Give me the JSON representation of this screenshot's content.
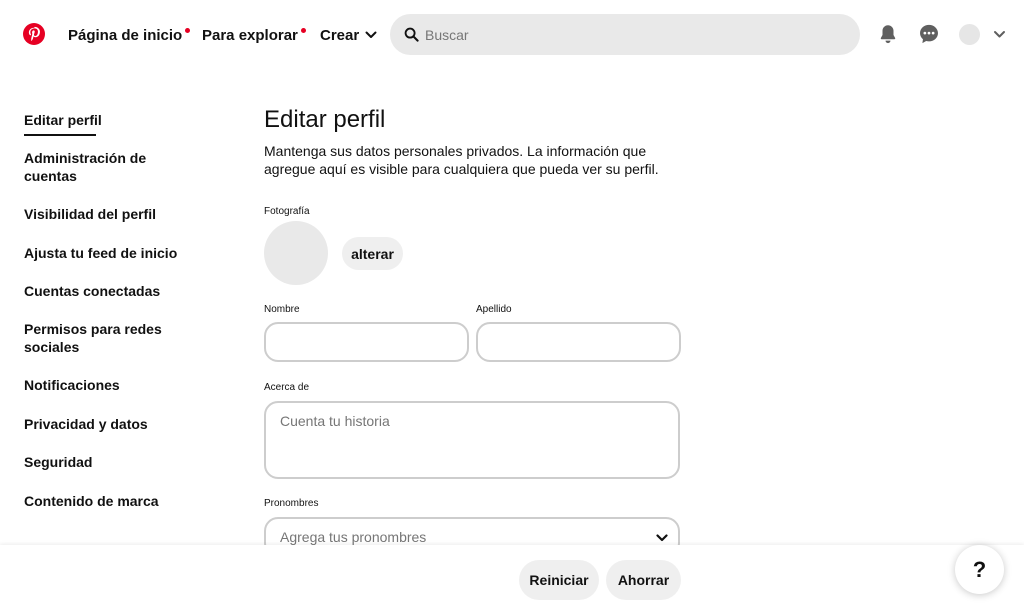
{
  "nav": {
    "logo_icon": "pinterest-logo",
    "home_label": "Página de inicio",
    "explore_label": "Para explorar",
    "create_label": "Crear",
    "search_placeholder": "Buscar",
    "accent_color": "#e60023"
  },
  "sidebar": {
    "items": [
      {
        "label": "Editar perfil",
        "active": true
      },
      {
        "label": "Administración de cuentas"
      },
      {
        "label": "Visibilidad del perfil"
      },
      {
        "label": "Ajusta tu feed de inicio"
      },
      {
        "label": "Cuentas conectadas"
      },
      {
        "label": "Permisos para redes sociales"
      },
      {
        "label": "Notificaciones"
      },
      {
        "label": "Privacidad y datos"
      },
      {
        "label": "Seguridad"
      },
      {
        "label": "Contenido de marca"
      }
    ]
  },
  "main": {
    "title": "Editar perfil",
    "description": "Mantenga sus datos personales privados. La información que agregue aquí es visible para cualquiera que pueda ver su perfil.",
    "photo_label": "Fotografía",
    "change_button": "alterar",
    "first_name_label": "Nombre",
    "first_name_value": "",
    "last_name_label": "Apellido",
    "last_name_value": "",
    "about_label": "Acerca de",
    "about_placeholder": "Cuenta tu historia",
    "pronouns_label": "Pronombres",
    "pronouns_placeholder": "Agrega tus pronombres"
  },
  "footer": {
    "reset_label": "Reiniciar",
    "save_label": "Ahorrar",
    "help_label": "?"
  }
}
